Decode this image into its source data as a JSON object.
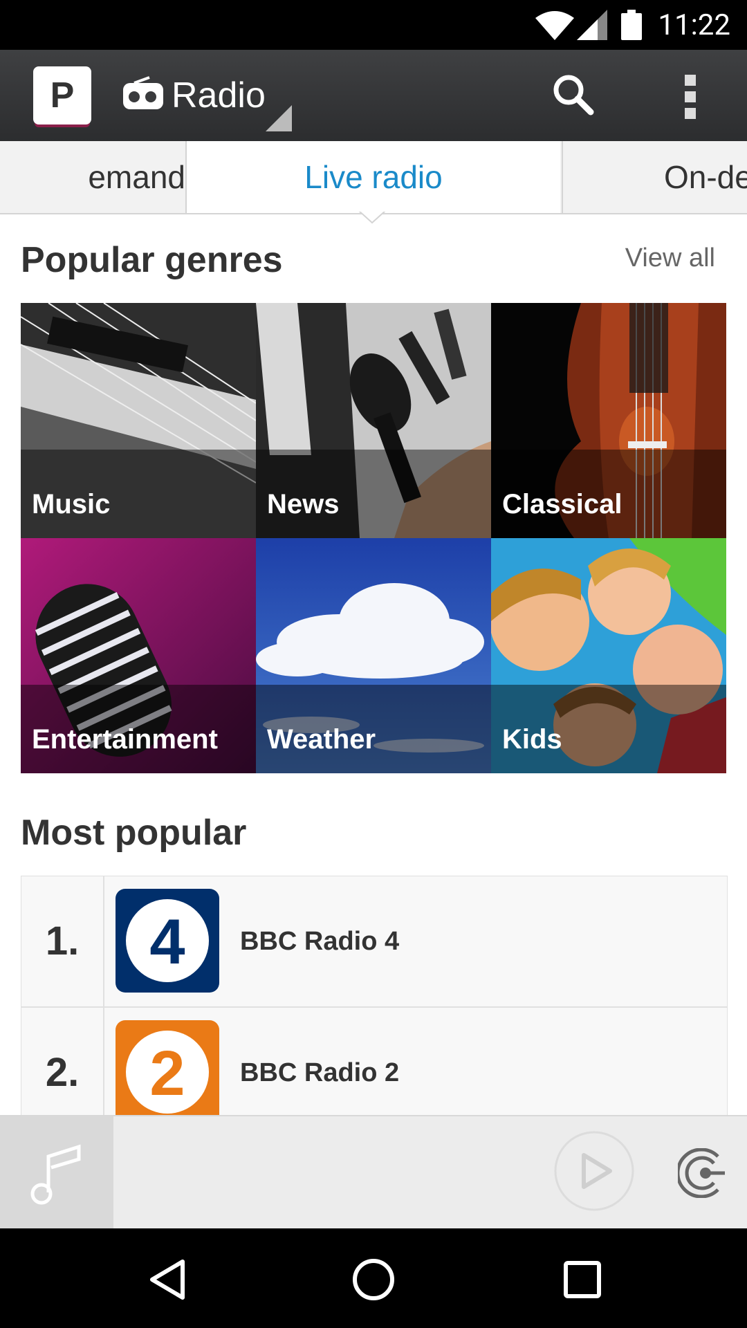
{
  "status": {
    "time": "11:22"
  },
  "app": {
    "logo_letter": "P",
    "title": "Radio"
  },
  "tabs": [
    {
      "label": "emand"
    },
    {
      "label": "Live radio"
    },
    {
      "label": "On-de"
    }
  ],
  "genres": {
    "title": "Popular genres",
    "view_all": "View all",
    "items": [
      {
        "label": "Music"
      },
      {
        "label": "News"
      },
      {
        "label": "Classical"
      },
      {
        "label": "Entertainment"
      },
      {
        "label": "Weather"
      },
      {
        "label": "Kids"
      }
    ]
  },
  "popular": {
    "title": "Most popular",
    "items": [
      {
        "rank": "1.",
        "name": "BBC Radio 4",
        "logo_text": "4",
        "logo_color": "#012f6b"
      },
      {
        "rank": "2.",
        "name": "BBC Radio 2",
        "logo_text": "2",
        "logo_color": "#ea7a16"
      }
    ]
  },
  "colors": {
    "accent": "#1a8ac9",
    "radio4": "#012f6b",
    "radio2": "#ea7a16"
  }
}
